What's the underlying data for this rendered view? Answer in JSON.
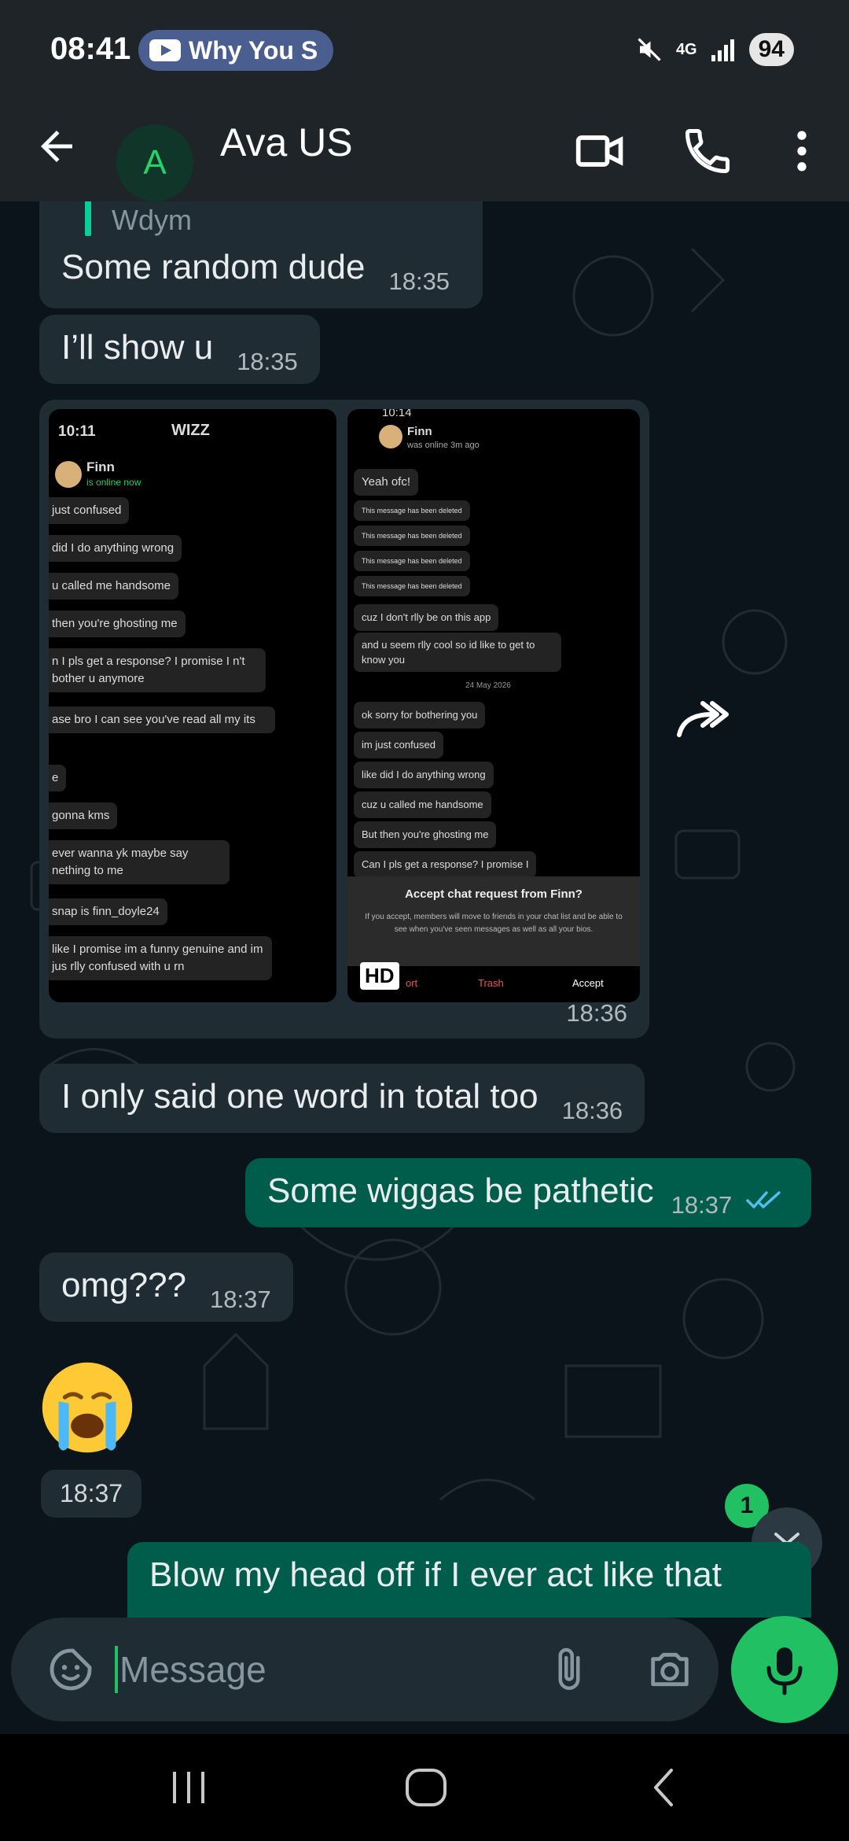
{
  "status_bar": {
    "time": "08:41",
    "media_pill": "Why You S",
    "network": "4G",
    "battery": "94"
  },
  "header": {
    "avatar_letter": "A",
    "contact_name": "Ava US"
  },
  "messages": {
    "quote_preview": "Wdym",
    "m1": {
      "text": "Some random dude",
      "time": "18:35"
    },
    "m2": {
      "text": "I’ll show u",
      "time": "18:35"
    },
    "image_time": "18:36",
    "m3": {
      "text": "I only said one word in total too",
      "time": "18:36"
    },
    "m4": {
      "text": "Some wiggas be pathetic",
      "time": "18:37"
    },
    "m5": {
      "text": "omg???",
      "time": "18:37"
    },
    "emoji_time": "18:37",
    "m6": {
      "text": "Blow my head off if I ever act like that"
    }
  },
  "screenshot_left": {
    "time": "10:11",
    "app": "WIZZ",
    "name": "Finn",
    "status": "is online now",
    "messages": [
      "just confused",
      "did I do anything wrong",
      "u called me handsome",
      "then you're ghosting me",
      "n I pls get a response? I promise I n't bother u anymore",
      "ase bro I can see you've read all my its",
      "e",
      "gonna kms",
      "ever wanna yk maybe say nething to me",
      "snap is finn_doyle24",
      "like I promise im a funny genuine and im jus rlly confused with u rn"
    ]
  },
  "screenshot_right": {
    "time": "10:14",
    "name": "Finn",
    "status": "was online 3m ago",
    "messages": [
      "Yeah ofc!",
      "This message has been deleted",
      "This message has been deleted",
      "This message has been deleted",
      "This message has been deleted",
      "cuz I don't rlly be on this app",
      "and u seem rlly cool so id like to get to know you",
      "ok sorry for bothering you",
      "im just confused",
      "like did I do anything wrong",
      "cuz u called me handsome",
      "But then you're ghosting me",
      "Can I pls get a response? I promise I"
    ],
    "date_divider": "24 May 2026",
    "request_title": "Accept chat request from Finn?",
    "request_body": "If you accept, members will move to friends in your chat list and be able to see when you've seen messages as well as all your bios.",
    "btn_report": "ort",
    "btn_trash": "Trash",
    "btn_accept": "Accept",
    "hd": "HD"
  },
  "scroll": {
    "unread_count": "1"
  },
  "composer": {
    "placeholder": "Message"
  }
}
